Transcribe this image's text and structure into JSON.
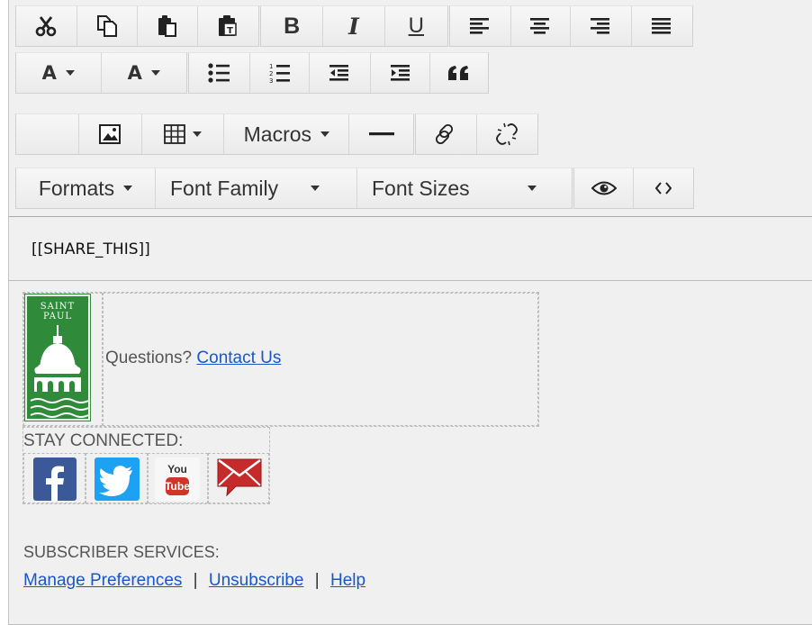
{
  "toolbar": {
    "row1": {
      "cut": "cut-icon",
      "copy": "copy-icon",
      "paste": "paste-icon",
      "paste_text": "paste-as-text-icon",
      "bold": "B",
      "italic": "I",
      "underline": "U",
      "align": [
        "align-left-icon",
        "align-center-icon",
        "align-right-icon",
        "align-justify-icon"
      ]
    },
    "row2": {
      "text_color": "A",
      "bg_color": "A",
      "lists": [
        "bullet-list-icon",
        "numbered-list-icon",
        "outdent-icon",
        "indent-icon",
        "blockquote-icon"
      ]
    },
    "row3": {
      "macros_label": "Macros"
    },
    "row4": {
      "formats_label": "Formats",
      "font_family_label": "Font Family",
      "font_sizes_label": "Font Sizes"
    }
  },
  "content": {
    "share_tag": "[[SHARE_THIS]]",
    "logo_text": "SAINT\nPAUL",
    "questions": "Questions?",
    "contact_link": "Contact Us",
    "stay_connected": "STAY CONNECTED:",
    "social": [
      "facebook-icon",
      "twitter-icon",
      "youtube-icon",
      "email-icon"
    ],
    "youtube_text": [
      "You",
      "Tube"
    ],
    "subscriber_services": "SUBSCRIBER SERVICES:",
    "links": [
      "Manage Preferences",
      "Unsubscribe",
      "Help"
    ],
    "divider": "|"
  },
  "colors": {
    "link": "#1a56c7",
    "logo_green": "#2f8a3a",
    "facebook": "#3b5998",
    "twitter": "#1da1f2",
    "youtube_red": "#d0352b",
    "email_red": "#c62b2b"
  }
}
